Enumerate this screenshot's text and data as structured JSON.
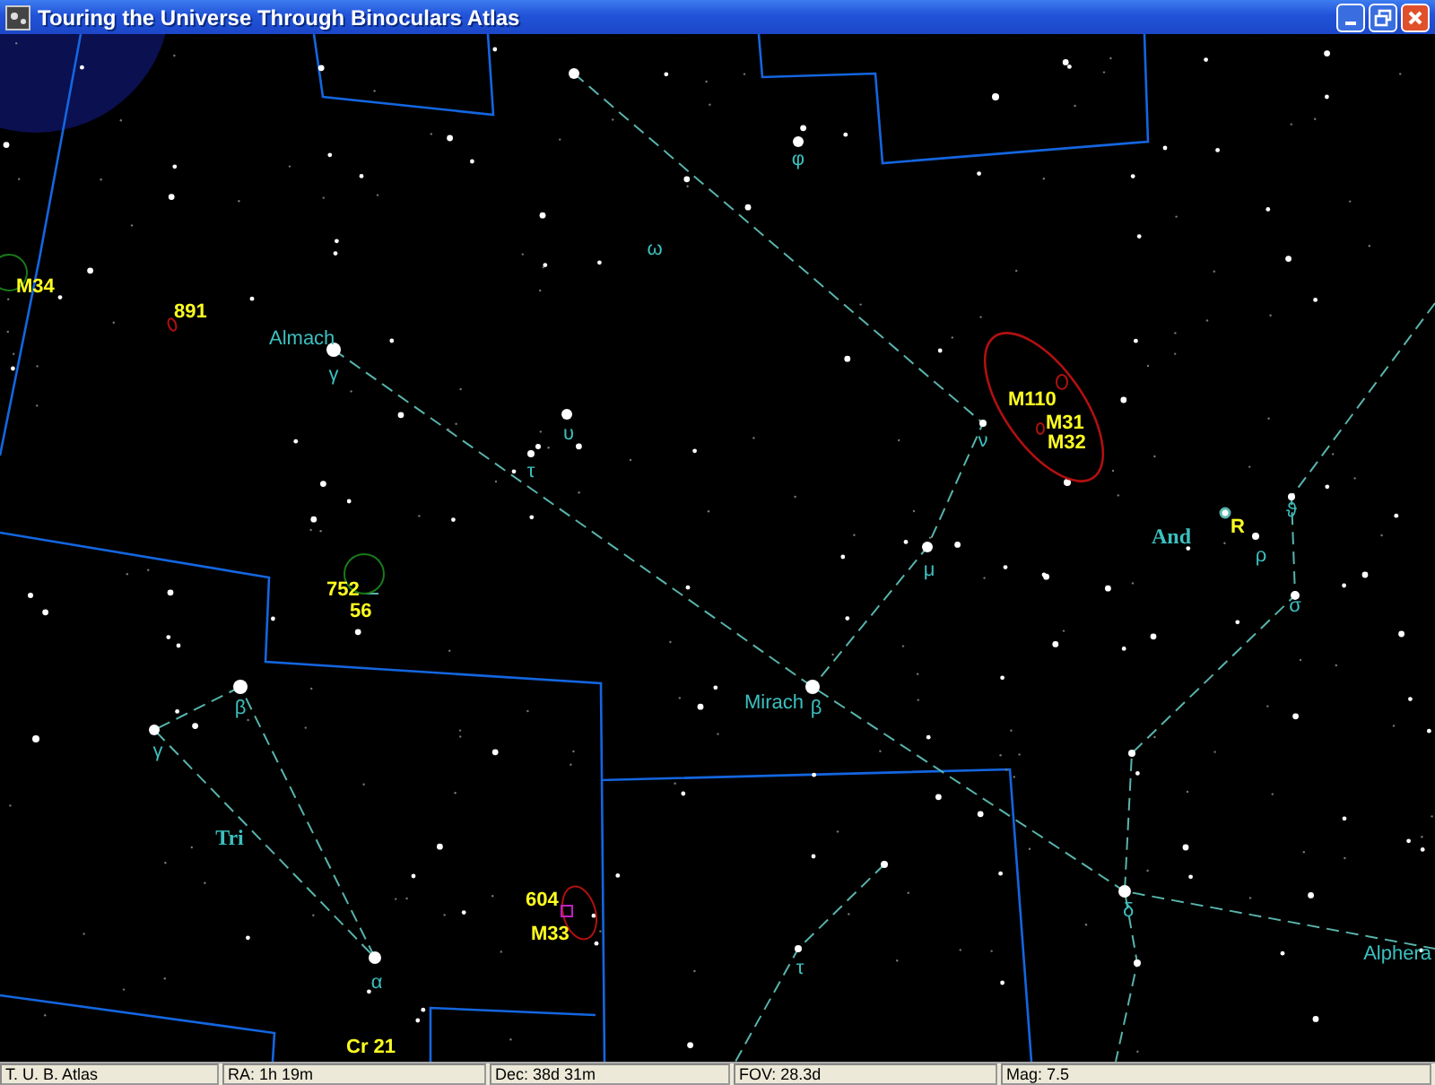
{
  "window": {
    "title": "Touring the Universe Through Binoculars Atlas"
  },
  "chart_labels": [
    {
      "text": "φ",
      "kind": "star"
    },
    {
      "text": "ω",
      "kind": "star"
    },
    {
      "text": "Almach",
      "kind": "star"
    },
    {
      "text": "γ",
      "kind": "star"
    },
    {
      "text": "υ",
      "kind": "star"
    },
    {
      "text": "τ",
      "kind": "star"
    },
    {
      "text": "ν",
      "kind": "star"
    },
    {
      "text": "μ",
      "kind": "star"
    },
    {
      "text": "ϑ",
      "kind": "star"
    },
    {
      "text": "ρ",
      "kind": "star"
    },
    {
      "text": "σ",
      "kind": "star"
    },
    {
      "text": "β",
      "kind": "star"
    },
    {
      "text": "Mirach",
      "kind": "star"
    },
    {
      "text": "β",
      "kind": "star"
    },
    {
      "text": "γ",
      "kind": "star"
    },
    {
      "text": "α",
      "kind": "star"
    },
    {
      "text": "δ",
      "kind": "star"
    },
    {
      "text": "τ",
      "kind": "star"
    },
    {
      "text": "Alphera",
      "kind": "star"
    },
    {
      "text": "And",
      "kind": "constellation"
    },
    {
      "text": "Tri",
      "kind": "constellation"
    },
    {
      "text": "M34",
      "kind": "object"
    },
    {
      "text": "891",
      "kind": "object"
    },
    {
      "text": "M110",
      "kind": "object"
    },
    {
      "text": "M31",
      "kind": "object"
    },
    {
      "text": "M32",
      "kind": "object"
    },
    {
      "text": "R",
      "kind": "object"
    },
    {
      "text": "752",
      "kind": "object"
    },
    {
      "text": "56",
      "kind": "object"
    },
    {
      "text": "604",
      "kind": "object"
    },
    {
      "text": "M33",
      "kind": "object"
    },
    {
      "text": "Cr 21",
      "kind": "object"
    }
  ],
  "status_bar": [
    "T. U. B. Atlas",
    "RA: 1h 19m",
    "Dec: 38d 31m",
    "FOV: 28.3d",
    "Mag: 7.5"
  ]
}
